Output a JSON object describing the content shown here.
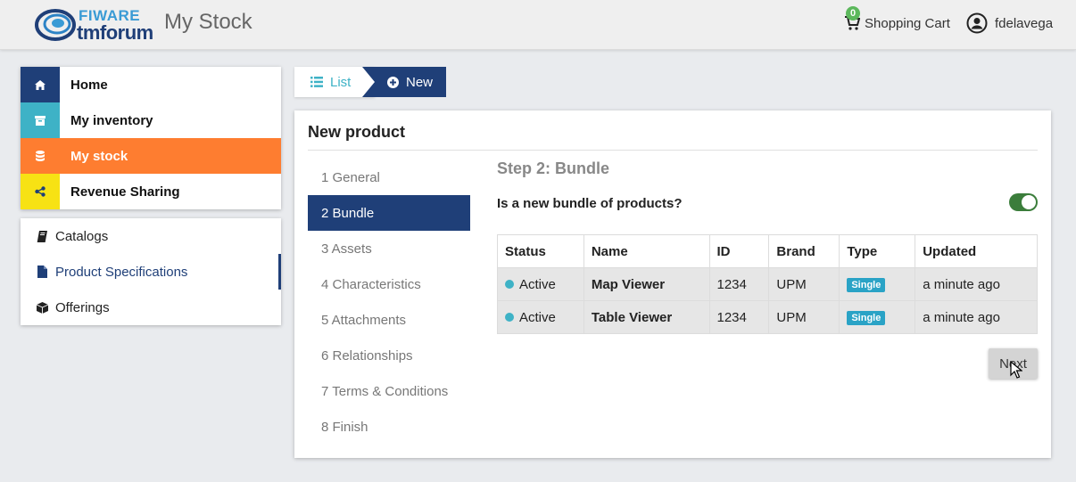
{
  "header": {
    "logo_fiware": "FIWARE",
    "logo_tmforum": "tmforum",
    "app_title": "My Stock",
    "cart_count": "0",
    "cart_label": "Shopping Cart",
    "username": "fdelavega"
  },
  "sidebar": {
    "main": [
      {
        "label": "Home",
        "icon": "home-icon"
      },
      {
        "label": "My inventory",
        "icon": "archive-icon"
      },
      {
        "label": "My stock",
        "icon": "database-icon"
      },
      {
        "label": "Revenue Sharing",
        "icon": "share-icon"
      }
    ],
    "sub": [
      {
        "label": "Catalogs",
        "icon": "book-icon"
      },
      {
        "label": "Product Specifications",
        "icon": "file-icon"
      },
      {
        "label": "Offerings",
        "icon": "cube-icon"
      }
    ]
  },
  "breadcrumb": {
    "list_label": "List",
    "new_label": "New"
  },
  "card": {
    "title": "New product",
    "steps": [
      "1 General",
      "2 Bundle",
      "3 Assets",
      "4 Characteristics",
      "5 Attachments",
      "6 Relationships",
      "7 Terms & Conditions",
      "8 Finish"
    ],
    "active_step": 1,
    "step_heading": "Step 2: Bundle",
    "bundle_question": "Is a new bundle of products?",
    "bundle_toggle_on": true,
    "table": {
      "headers": [
        "Status",
        "Name",
        "ID",
        "Brand",
        "Type",
        "Updated"
      ],
      "rows": [
        {
          "status": "Active",
          "name": "Map Viewer",
          "id": "1234",
          "brand": "UPM",
          "type": "Single",
          "updated": "a minute ago"
        },
        {
          "status": "Active",
          "name": "Table Viewer",
          "id": "1234",
          "brand": "UPM",
          "type": "Single",
          "updated": "a minute ago"
        }
      ]
    },
    "next_label": "Next"
  },
  "colors": {
    "navy": "#1f3f78",
    "teal": "#3eb2c6",
    "orange": "#fe7d30",
    "yellow": "#f7e214",
    "toggle_green": "#3b7d3b"
  }
}
